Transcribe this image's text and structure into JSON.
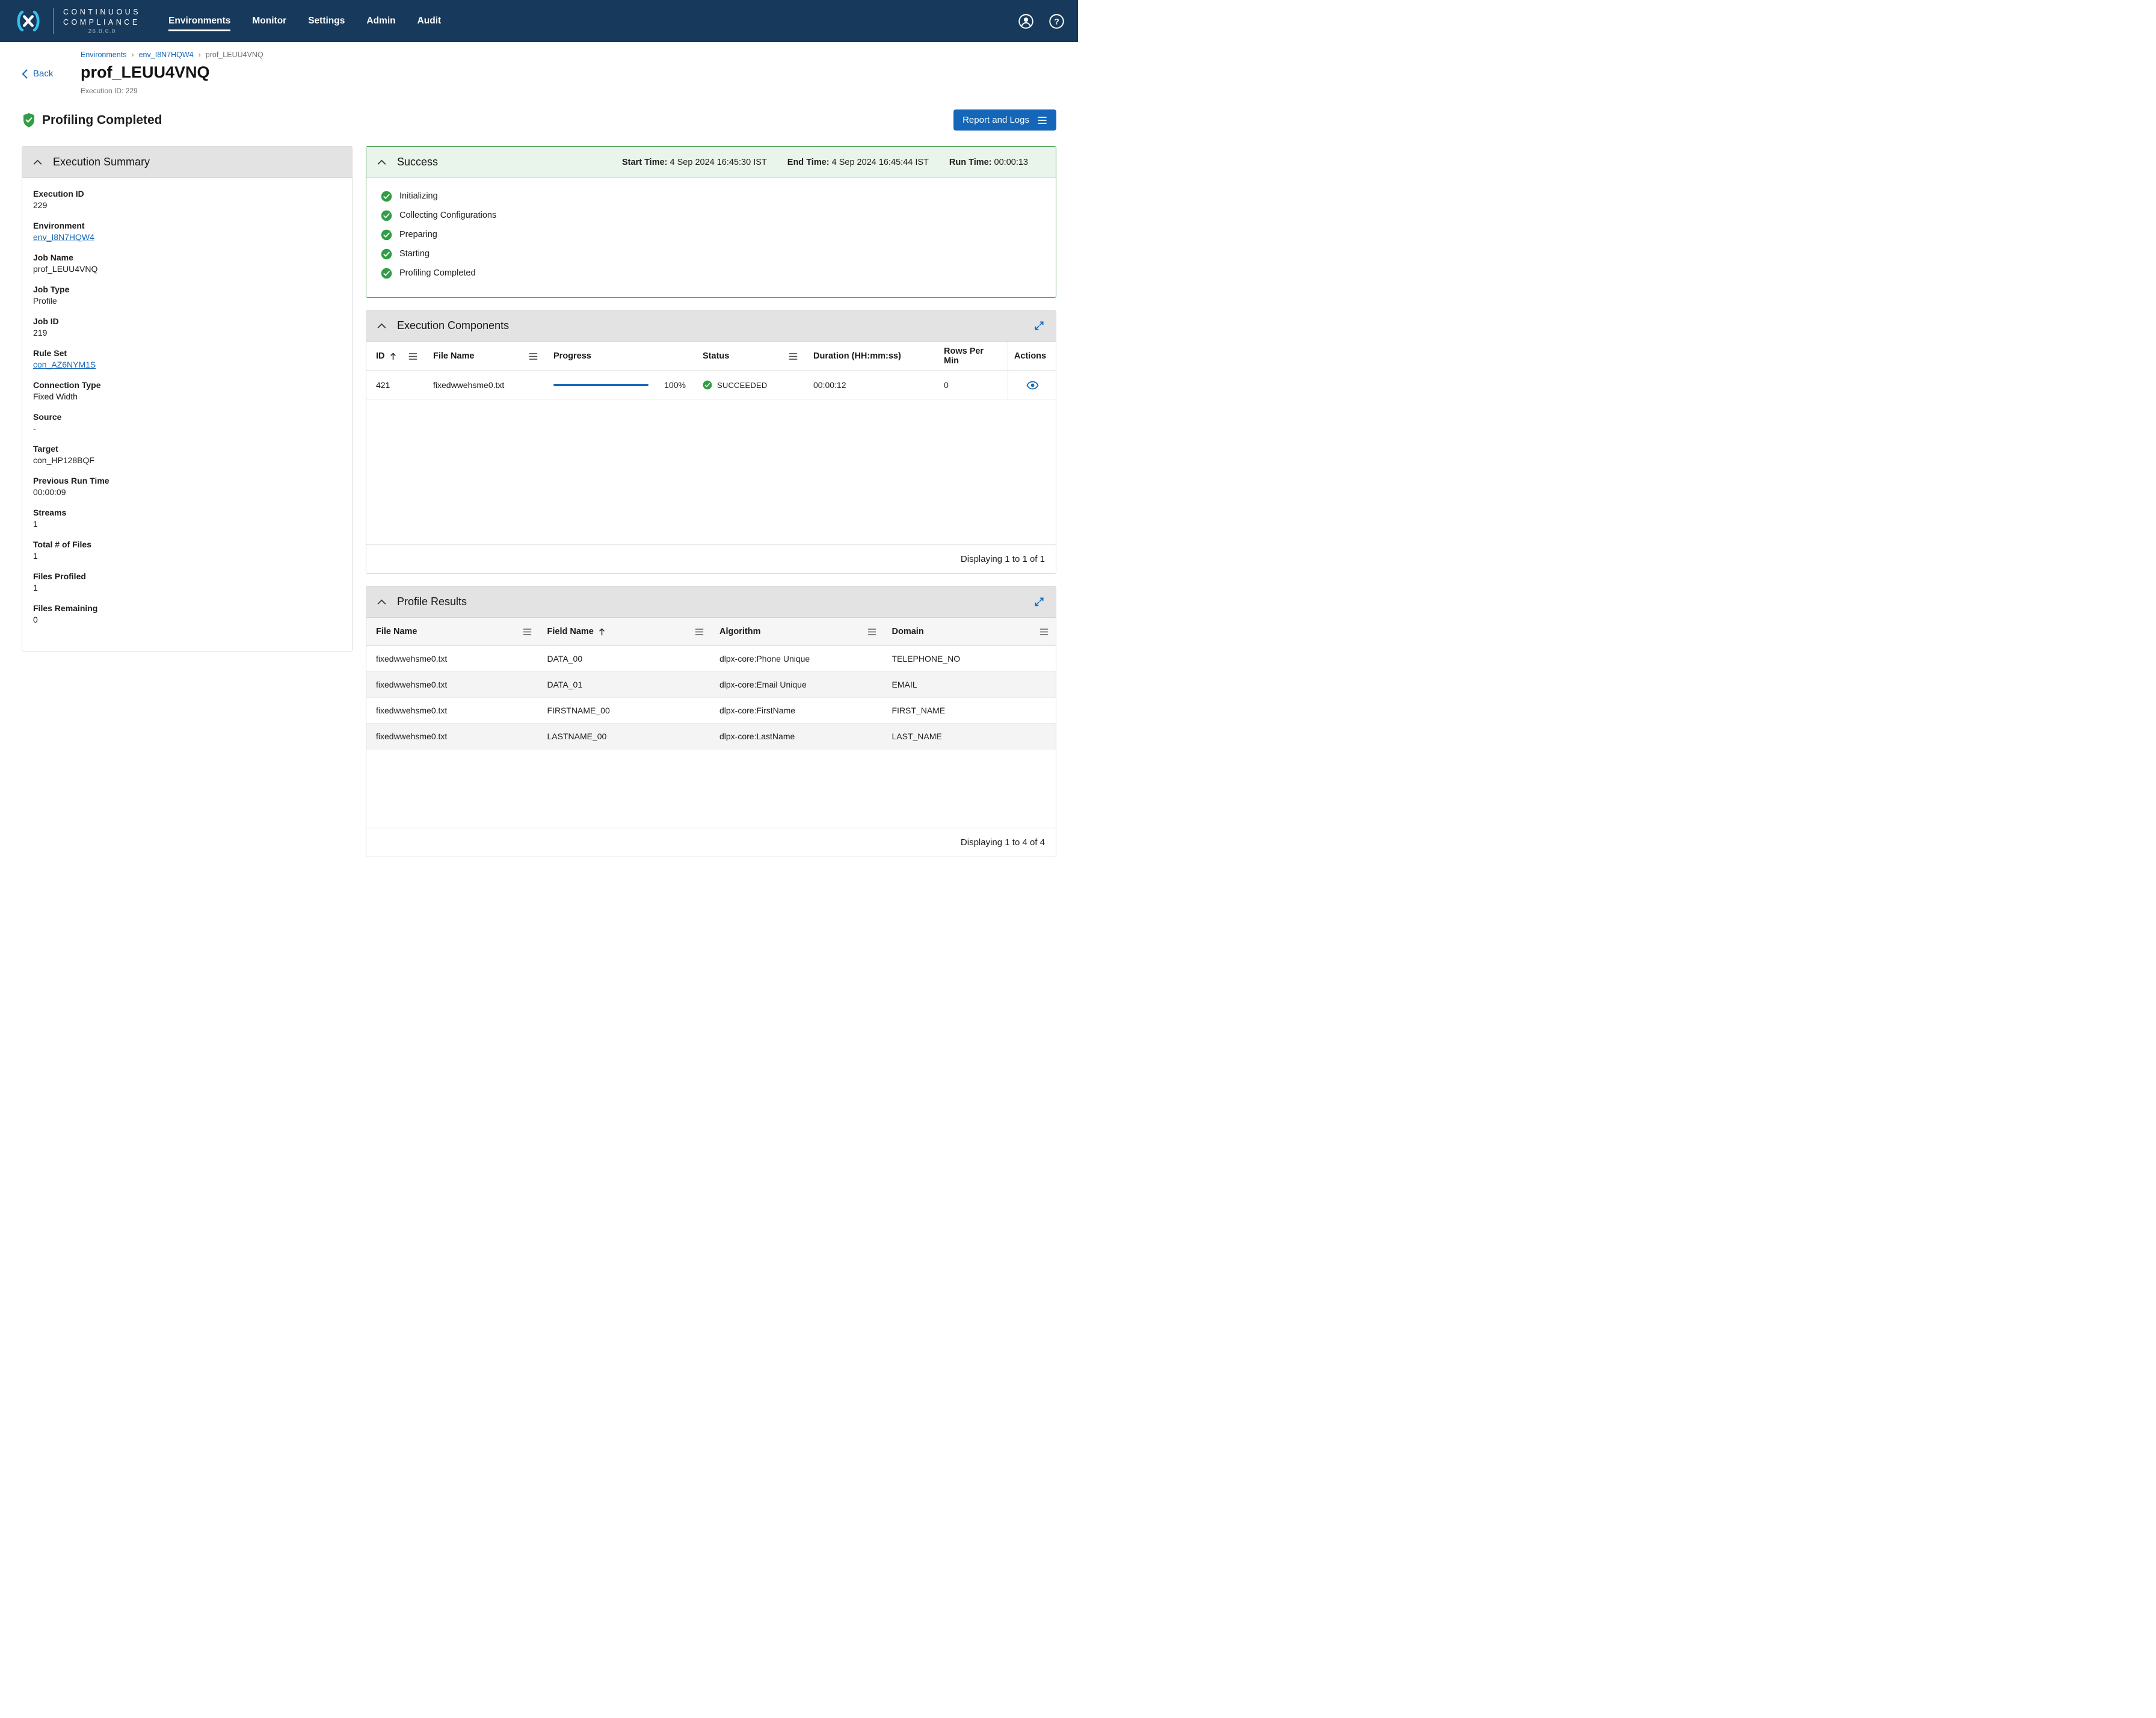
{
  "colors": {
    "navbar_bg": "#17395B",
    "accent_blue": "#1467B8",
    "logo_cyan": "#35BEEA",
    "success_green": "#2F9E44",
    "success_border": "#57A05B",
    "success_header_bg": "#E9F4EA",
    "panel_header_bg": "#E3E3E3",
    "row_alt_bg": "#F4F4F4"
  },
  "icons": {
    "logo": "delphix-logo",
    "account": "account-icon",
    "help": "help-icon",
    "back": "chevron-left-icon",
    "status": "shield-check-icon",
    "step": "check-circle-icon",
    "collapse": "chevron-up-icon",
    "expand": "expand-icon",
    "column_menu": "menu-icon",
    "sort": "sort-asc-icon",
    "view": "eye-icon"
  },
  "navbar": {
    "brand_line1": "CONTINUOUS",
    "brand_line2": "COMPLIANCE",
    "version": "26.0.0.0",
    "items": [
      {
        "label": "Environments",
        "active": true
      },
      {
        "label": "Monitor"
      },
      {
        "label": "Settings"
      },
      {
        "label": "Admin"
      },
      {
        "label": "Audit"
      }
    ]
  },
  "breadcrumb": {
    "separator": "›",
    "items": [
      {
        "label": "Environments",
        "link": true
      },
      {
        "label": "env_I8N7HQW4",
        "link": true
      },
      {
        "label": "prof_LEUU4VNQ",
        "link": false
      }
    ]
  },
  "header": {
    "back_label": "Back",
    "title": "prof_LEUU4VNQ",
    "subtitle": "Execution ID: 229"
  },
  "status": {
    "label": "Profiling Completed",
    "report_button": "Report and Logs"
  },
  "execution_summary": {
    "title": "Execution Summary",
    "fields": [
      {
        "label": "Execution ID",
        "value": "229"
      },
      {
        "label": "Environment",
        "value": "env_I8N7HQW4",
        "link": true
      },
      {
        "label": "Job Name",
        "value": "prof_LEUU4VNQ"
      },
      {
        "label": "Job Type",
        "value": "Profile"
      },
      {
        "label": "Job ID",
        "value": "219"
      },
      {
        "label": "Rule Set",
        "value": "con_AZ6NYM1S",
        "link": true
      },
      {
        "label": "Connection Type",
        "value": "Fixed Width"
      },
      {
        "label": "Source",
        "value": "-"
      },
      {
        "label": "Target",
        "value": "con_HP128BQF"
      },
      {
        "label": "Previous Run Time",
        "value": "00:00:09"
      },
      {
        "label": "Streams",
        "value": "1"
      },
      {
        "label": "Total # of Files",
        "value": "1"
      },
      {
        "label": "Files Profiled",
        "value": "1"
      },
      {
        "label": "Files Remaining",
        "value": "0"
      }
    ]
  },
  "success_panel": {
    "title": "Success",
    "start_time_label": "Start Time:",
    "start_time": "4 Sep 2024 16:45:30 IST",
    "end_time_label": "End Time:",
    "end_time": "4 Sep 2024 16:45:44 IST",
    "run_time_label": "Run Time:",
    "run_time": "00:00:13",
    "steps": [
      "Initializing",
      "Collecting Configurations",
      "Preparing",
      "Starting",
      "Profiling Completed"
    ]
  },
  "execution_components": {
    "title": "Execution Components",
    "columns": [
      {
        "label": "ID",
        "sort": true,
        "menu": true
      },
      {
        "label": "File Name",
        "menu": true
      },
      {
        "label": "Progress"
      },
      {
        "label": "Status",
        "menu": true
      },
      {
        "label": "Duration (HH:mm:ss)"
      },
      {
        "label": "Rows Per Min"
      },
      {
        "label": "Actions"
      }
    ],
    "rows": [
      {
        "id": "421",
        "file_name": "fixedwwehsme0.txt",
        "progress_value": 100,
        "progress_pct": "100%",
        "status": "SUCCEEDED",
        "duration": "00:00:12",
        "rows_per_min": "0"
      }
    ],
    "footer": "Displaying 1 to 1 of 1"
  },
  "profile_results": {
    "title": "Profile Results",
    "columns": [
      {
        "label": "File Name",
        "menu": true
      },
      {
        "label": "Field Name",
        "sort": true,
        "menu": true
      },
      {
        "label": "Algorithm",
        "menu": true
      },
      {
        "label": "Domain",
        "menu": true
      }
    ],
    "rows": [
      {
        "file_name": "fixedwwehsme0.txt",
        "field_name": "DATA_00",
        "algorithm": "dlpx-core:Phone Unique",
        "domain": "TELEPHONE_NO"
      },
      {
        "file_name": "fixedwwehsme0.txt",
        "field_name": "DATA_01",
        "algorithm": "dlpx-core:Email Unique",
        "domain": "EMAIL"
      },
      {
        "file_name": "fixedwwehsme0.txt",
        "field_name": "FIRSTNAME_00",
        "algorithm": "dlpx-core:FirstName",
        "domain": "FIRST_NAME"
      },
      {
        "file_name": "fixedwwehsme0.txt",
        "field_name": "LASTNAME_00",
        "algorithm": "dlpx-core:LastName",
        "domain": "LAST_NAME"
      }
    ],
    "footer": "Displaying 1 to 4 of 4"
  }
}
